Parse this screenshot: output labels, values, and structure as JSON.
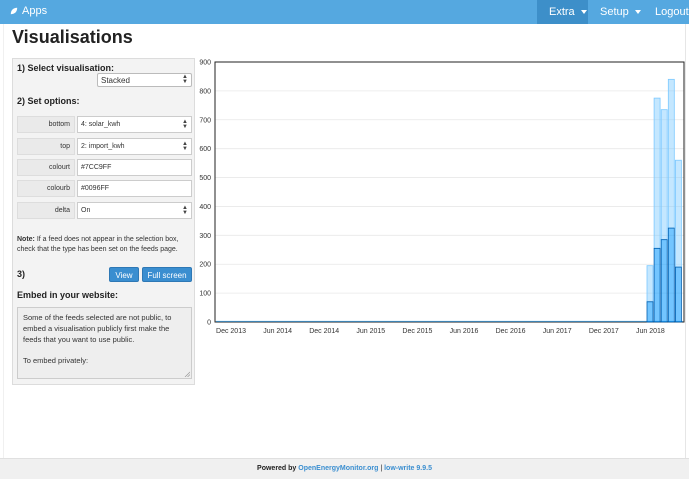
{
  "topbar": {
    "brand_label": "Apps",
    "menus": [
      {
        "label": "Extra"
      },
      {
        "label": "Setup"
      },
      {
        "label": "Logout"
      }
    ]
  },
  "page_title": "Visualisations",
  "panel": {
    "select_title": "1) Select visualisation:",
    "visualisation_value": "Stacked",
    "options_title": "2) Set options:",
    "options": [
      {
        "label": "bottom",
        "value": "4: solar_kwh",
        "type": "select"
      },
      {
        "label": "top",
        "value": "2: import_kwh",
        "type": "select"
      },
      {
        "label": "colourt",
        "value": "#7CC9FF",
        "type": "input"
      },
      {
        "label": "colourb",
        "value": "#0096FF",
        "type": "input"
      },
      {
        "label": "delta",
        "value": "On",
        "type": "select"
      }
    ],
    "note_bold": "Note:",
    "note_text": " If a feed does not appear in the selection box, check that the type has been set on the feeds page.",
    "step3": "3)",
    "view_button": "View",
    "fullscreen_button": "Full screen",
    "embed_title": "Embed in your website:",
    "embed_text_1": "Some of the feeds selected are not public, to embed a visualisation publicly first make the feeds that you want to use public.",
    "embed_text_2": "To embed privately:"
  },
  "chart_data": {
    "type": "bar",
    "stacked": true,
    "x_tick_labels": [
      "Dec 2013",
      "Jun 2014",
      "Dec 2014",
      "Jun 2015",
      "Dec 2015",
      "Jun 2016",
      "Dec 2016",
      "Jun 2017",
      "Dec 2017",
      "Jun 2018"
    ],
    "ylim": [
      0,
      900
    ],
    "y_ticks": [
      0,
      100,
      200,
      300,
      400,
      500,
      600,
      700,
      800,
      900
    ],
    "colors": {
      "bottom": "#0096FF",
      "top": "#7CC9FF"
    },
    "bars_2018": [
      {
        "bottom": 70,
        "total": 195
      },
      {
        "bottom": 255,
        "total": 775
      },
      {
        "bottom": 285,
        "total": 735
      },
      {
        "bottom": 325,
        "total": 840
      },
      {
        "bottom": 190,
        "total": 560
      }
    ]
  },
  "footer": {
    "powered_by": "Powered by ",
    "link_text": "OpenEnergyMonitor.org",
    "separator": " | ",
    "version_text": "low-write 9.9.5"
  }
}
